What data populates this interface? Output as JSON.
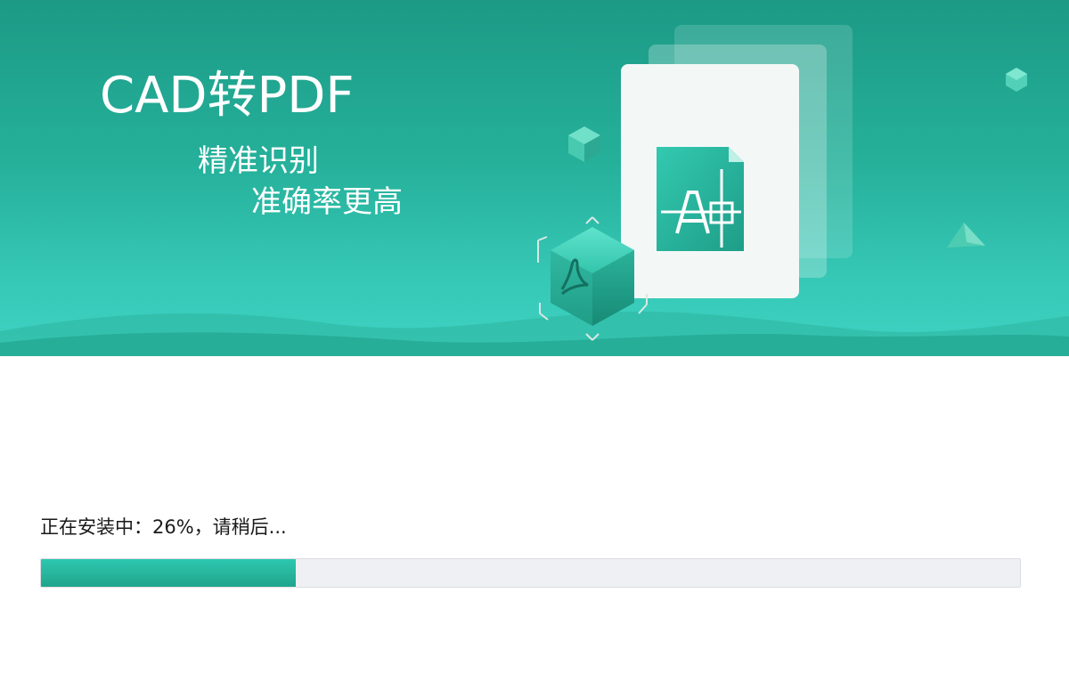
{
  "banner": {
    "title": "CAD转PDF",
    "subtitle_line1": "精准识别",
    "subtitle_line2": "准确率更高",
    "colors": {
      "primary": "#24ad97",
      "light": "#40d2c3",
      "dark": "#1c9a86"
    },
    "icons": [
      "cad-file-icon",
      "pdf-cube-icon"
    ]
  },
  "install": {
    "status_text": "正在安装中：26%，请稍后...",
    "progress_fraction": 0.26,
    "accent_color": "#27b49c",
    "track_color": "#eff0f3"
  }
}
